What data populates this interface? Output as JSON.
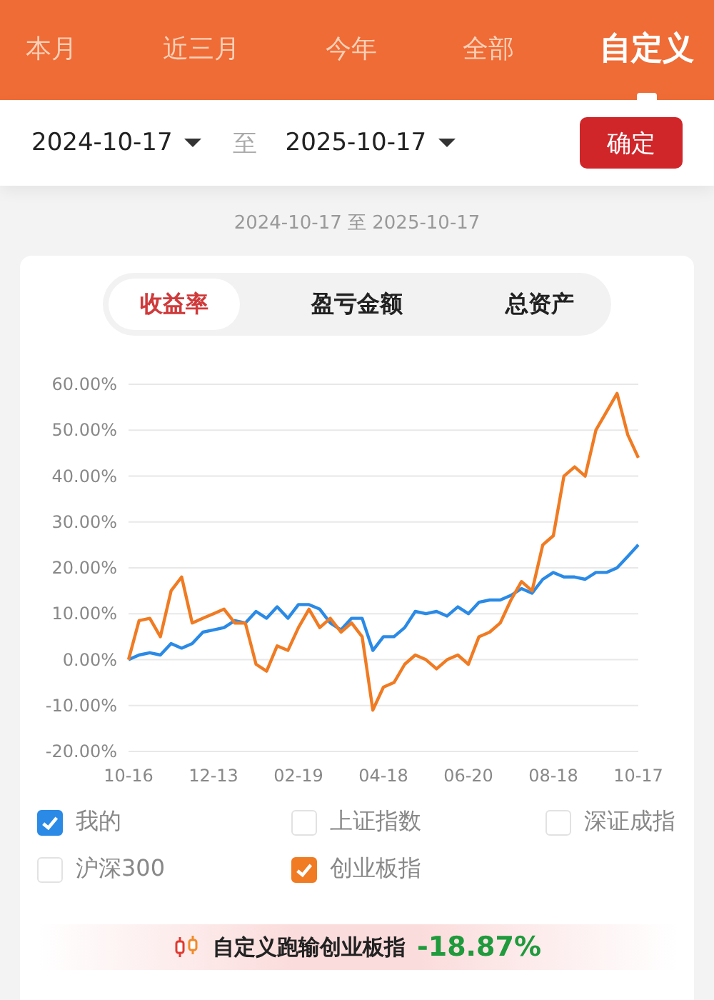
{
  "tabs": [
    {
      "label": "本月",
      "selected": false
    },
    {
      "label": "近三月",
      "selected": false
    },
    {
      "label": "今年",
      "selected": false
    },
    {
      "label": "全部",
      "selected": false
    },
    {
      "label": "自定义",
      "selected": true
    }
  ],
  "date_range": {
    "start": "2024-10-17",
    "separator": "至",
    "end": "2025-10-17",
    "confirm": "确定"
  },
  "period_label": "2024-10-17 至 2025-10-17",
  "segments": [
    {
      "label": "收益率",
      "selected": true
    },
    {
      "label": "盈亏金额",
      "selected": false
    },
    {
      "label": "总资产",
      "selected": false
    }
  ],
  "chart_data": {
    "type": "line",
    "categories": [
      "10-16",
      null,
      null,
      null,
      null,
      null,
      null,
      null,
      "12-13",
      null,
      null,
      null,
      null,
      null,
      null,
      null,
      "02-19",
      null,
      null,
      null,
      null,
      null,
      null,
      null,
      "04-18",
      null,
      null,
      null,
      null,
      null,
      null,
      null,
      "06-20",
      null,
      null,
      null,
      null,
      null,
      null,
      null,
      "08-18",
      null,
      null,
      null,
      null,
      null,
      null,
      null,
      "10-17"
    ],
    "series": [
      {
        "color": "#2a8ae6",
        "values": [
          0,
          1,
          1.5,
          1,
          3.5,
          2.5,
          3.5,
          6,
          6.5,
          7,
          8.5,
          8,
          10.5,
          9,
          11.5,
          9,
          12,
          12,
          11,
          8,
          6.5,
          9,
          9,
          2,
          5,
          5,
          7,
          10.5,
          10,
          10.5,
          9.5,
          11.5,
          10,
          12.5,
          13,
          13,
          14,
          15.5,
          14.5,
          17.5,
          19,
          18,
          18,
          17.5,
          19,
          19,
          20,
          22.5,
          25
        ]
      },
      {
        "color": "#f07b22",
        "values": [
          0,
          8.5,
          9,
          5,
          15,
          18,
          8,
          9,
          10,
          11,
          8,
          8,
          -1,
          -2.5,
          3,
          2,
          7,
          11,
          7,
          9,
          6,
          8,
          5,
          -11,
          -6,
          -5,
          -1,
          1,
          0,
          -2,
          0,
          1,
          -1,
          5,
          6,
          8,
          13,
          17,
          15,
          25,
          27,
          40,
          42,
          40,
          50,
          54,
          58,
          49,
          44
        ]
      }
    ],
    "grid": true,
    "ylim": [
      -20,
      60
    ],
    "yticks": [
      {
        "value": 60,
        "label": "60.00%"
      },
      {
        "value": 50,
        "label": "50.00%"
      },
      {
        "value": 40,
        "label": "40.00%"
      },
      {
        "value": 30,
        "label": "30.00%"
      },
      {
        "value": 20,
        "label": "20.00%"
      },
      {
        "value": 10,
        "label": "10.00%"
      },
      {
        "value": 0,
        "label": "0.00%"
      },
      {
        "value": -10,
        "label": "-10.00%"
      },
      {
        "value": -20,
        "label": "-20.00%"
      }
    ]
  },
  "legend": [
    {
      "label": "我的",
      "checked": true,
      "color": "#2a8ae6"
    },
    {
      "label": "上证指数",
      "checked": false
    },
    {
      "label": "深证成指",
      "checked": false
    },
    {
      "label": "沪深300",
      "checked": false
    },
    {
      "label": "创业板指",
      "checked": true,
      "color": "#f07b22"
    }
  ],
  "summary": {
    "text": "自定义跑输创业板指",
    "value": "-18.87%"
  }
}
